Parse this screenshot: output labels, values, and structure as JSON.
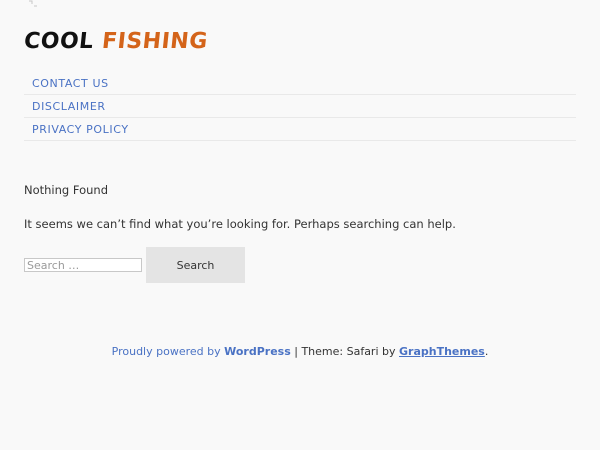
{
  "site": {
    "logo_word_1": "COOL",
    "logo_word_2": "FISHING",
    "logo_color_1": "#111111",
    "logo_color_2": "#d4641a"
  },
  "nav": {
    "items": [
      {
        "label": "CONTACT US"
      },
      {
        "label": "DISCLAIMER"
      },
      {
        "label": "PRIVACY POLICY"
      }
    ]
  },
  "main": {
    "title": "Nothing Found",
    "message": "It seems we can’t find what you’re looking for. Perhaps searching can help."
  },
  "search": {
    "placeholder": "Search …",
    "value": "",
    "button_label": "Search"
  },
  "footer": {
    "powered_prefix": "Proudly powered by ",
    "powered_link": "WordPress",
    "separator": " | Theme: Safari by ",
    "theme_author": "GraphThemes",
    "suffix": ".",
    "link_color": "#4a72c4"
  }
}
